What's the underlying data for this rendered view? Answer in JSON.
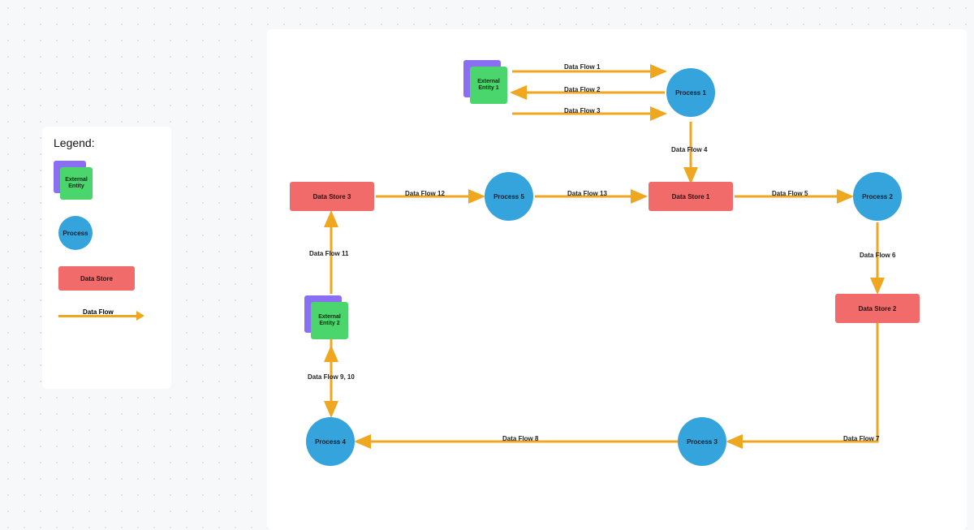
{
  "legend": {
    "title": "Legend:",
    "external_entity": "External\nEntity",
    "process": "Process",
    "data_store": "Data Store",
    "data_flow": "Data Flow"
  },
  "nodes": {
    "ext1": "External\nEntity 1",
    "ext2": "External\nEntity 2",
    "p1": "Process 1",
    "p2": "Process 2",
    "p3": "Process 3",
    "p4": "Process 4",
    "p5": "Process 5",
    "ds1": "Data Store 1",
    "ds2": "Data Store 2",
    "ds3": "Data Store 3"
  },
  "flows": {
    "f1": "Data Flow 1",
    "f2": "Data Flow 2",
    "f3": "Data Flow 3",
    "f4": "Data Flow 4",
    "f5": "Data Flow 5",
    "f6": "Data Flow 6",
    "f7": "Data Flow 7",
    "f8": "Data Flow 8",
    "f9": "Data Flow 9, 10",
    "f11": "Data Flow 11",
    "f12": "Data Flow 12",
    "f13": "Data Flow 13"
  },
  "chart_data": {
    "type": "diagram",
    "diagram_type": "data-flow-diagram",
    "nodes": [
      {
        "id": "ext1",
        "type": "external-entity",
        "label": "External Entity 1"
      },
      {
        "id": "ext2",
        "type": "external-entity",
        "label": "External Entity 2"
      },
      {
        "id": "p1",
        "type": "process",
        "label": "Process 1"
      },
      {
        "id": "p2",
        "type": "process",
        "label": "Process 2"
      },
      {
        "id": "p3",
        "type": "process",
        "label": "Process 3"
      },
      {
        "id": "p4",
        "type": "process",
        "label": "Process 4"
      },
      {
        "id": "p5",
        "type": "process",
        "label": "Process 5"
      },
      {
        "id": "ds1",
        "type": "data-store",
        "label": "Data Store 1"
      },
      {
        "id": "ds2",
        "type": "data-store",
        "label": "Data Store 2"
      },
      {
        "id": "ds3",
        "type": "data-store",
        "label": "Data Store 3"
      }
    ],
    "edges": [
      {
        "from": "ext1",
        "to": "p1",
        "label": "Data Flow 1"
      },
      {
        "from": "p1",
        "to": "ext1",
        "label": "Data Flow 2"
      },
      {
        "from": "ext1",
        "to": "p1",
        "label": "Data Flow 3"
      },
      {
        "from": "p1",
        "to": "ds1",
        "label": "Data Flow 4"
      },
      {
        "from": "ds1",
        "to": "p2",
        "label": "Data Flow 5"
      },
      {
        "from": "p2",
        "to": "ds2",
        "label": "Data Flow 6"
      },
      {
        "from": "ds2",
        "to": "p3",
        "label": "Data Flow 7"
      },
      {
        "from": "p3",
        "to": "p4",
        "label": "Data Flow 8"
      },
      {
        "from": "p4",
        "to": "ext2",
        "label": "Data Flow 9, 10",
        "bidirectional": true
      },
      {
        "from": "ext2",
        "to": "ds3",
        "label": "Data Flow 11"
      },
      {
        "from": "ds3",
        "to": "p5",
        "label": "Data Flow 12"
      },
      {
        "from": "p5",
        "to": "ds1",
        "label": "Data Flow 13"
      }
    ],
    "legend": [
      "External Entity",
      "Process",
      "Data Store",
      "Data Flow"
    ]
  }
}
